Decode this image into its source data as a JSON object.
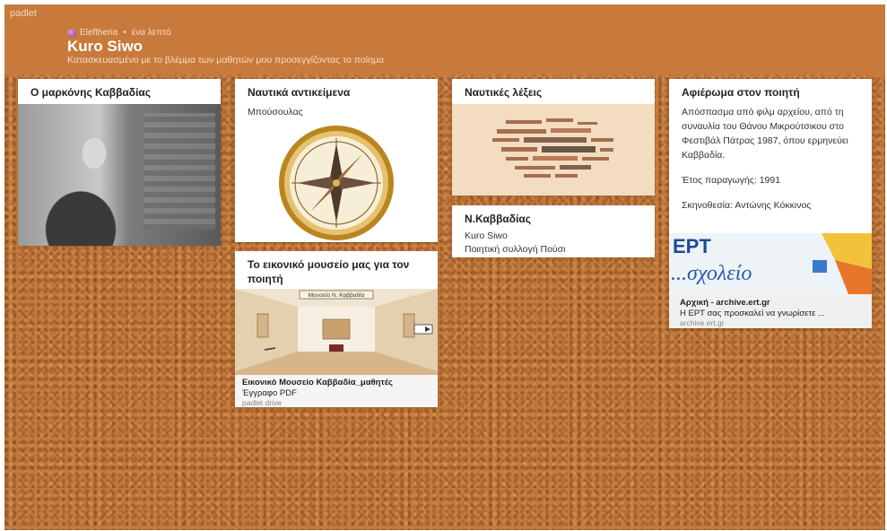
{
  "header": {
    "brand": "padlet",
    "author": "Eleftheria",
    "time": "ένα λεπτό",
    "title": "Kuro Siwo",
    "subtitle": "Κατασκευασμένο με το βλέμμα των μαθητών μου προσεγγίζοντας το ποίημα"
  },
  "posts": {
    "kavvadias": {
      "title": "Ο μαρκόνης Καββαδίας"
    },
    "nautika": {
      "title": "Ναυτικά αντικείμενα",
      "text": "Μπούσουλας"
    },
    "lexeis": {
      "title": "Ναυτικές λέξεις"
    },
    "nkavvadias": {
      "title": "Ν.Καββαδίας",
      "line1": "Kuro Siwo",
      "line2": "Ποιητική συλλογή Πούσι"
    },
    "museum": {
      "title": "Το εικονικό μουσείο μας για τον ποιητή",
      "image_sign": "Μουσείο Ν. Καββαδία",
      "file_title": "Εικονικό Μουσείο Καββαδία_μαθητές",
      "file_type": "Έγγραφο PDF",
      "file_source": "padlet drive"
    },
    "afieroma": {
      "title": "Αφιέρωμα στον ποιητή",
      "description": "Απόσπασμα από φιλμ αρχείου, από τη συναυλία του Θάνου Μικρούτσικου στο Φεστιβάλ Πάτρας 1987, όπου ερμηνεύει Καββαδία.",
      "year": "Έτος παραγωγής: 1991",
      "director": "Σκηνοθεσία: Αντώνης Κόκκινος",
      "image_text_1": "ΕΡΤ",
      "image_text_2": "...σχολείο",
      "link_title": "Αρχική - archive.ert.gr",
      "link_desc": "Η ΕΡΤ σας προσκαλεί να γνωρίσετε ...",
      "link_domain": "archive.ert.gr"
    }
  },
  "colors": {
    "header_bg": "#c87a3c",
    "cork": "#c47a3e",
    "card_bg": "#ffffff"
  }
}
